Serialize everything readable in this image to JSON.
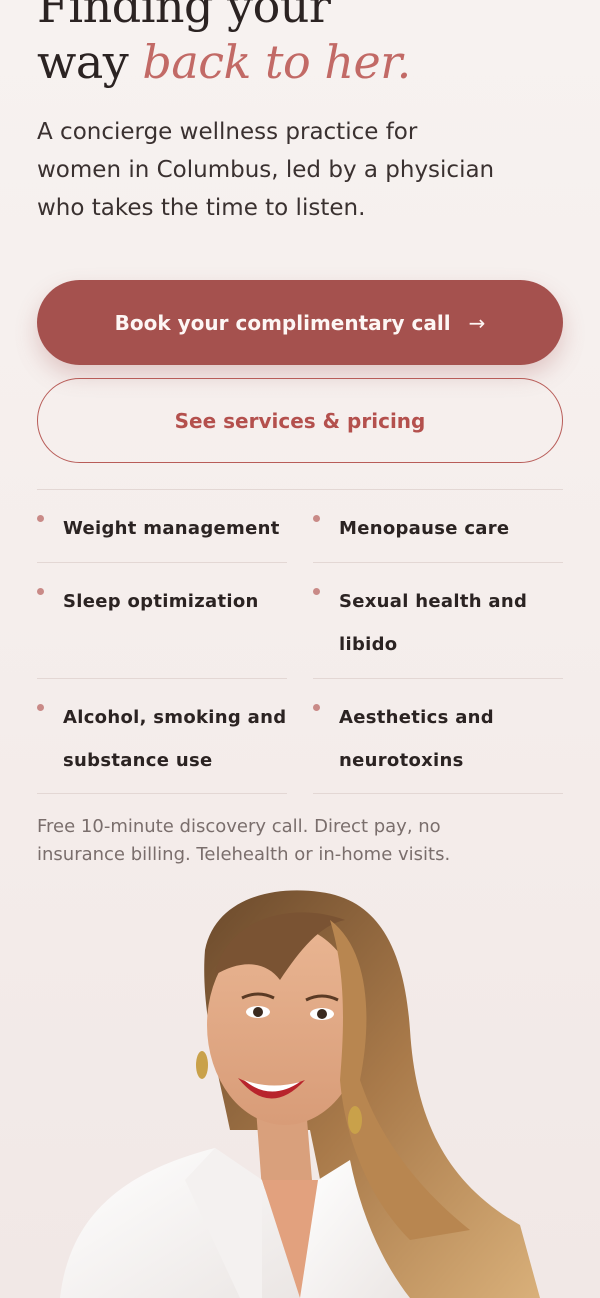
{
  "hero": {
    "title_line1": "Finding your",
    "title_line2_plain": "way",
    "title_line2_accent": "back to her.",
    "subtitle": "A concierge wellness practice for women in Columbus, led by a physician who takes the time to listen."
  },
  "cta": {
    "primary_label": "Book your complimentary call",
    "primary_arrow": "→",
    "secondary_label": "See services & pricing"
  },
  "services": [
    "Weight management",
    "Menopause care",
    "Sleep optimization",
    "Sexual health and libido",
    "Alcohol, smoking and substance use",
    "Aesthetics and neurotoxins"
  ],
  "footnote": "Free 10-minute discovery call. Direct pay, no insurance billing. Telehealth or in-home visits.",
  "colors": {
    "accent": "#a5514e",
    "accent_text": "#c26a66",
    "background": "#f5eeec",
    "bullet": "#c98a87"
  },
  "icons": {
    "arrow": "arrow-right-icon",
    "bullet": "bullet-dot-icon"
  }
}
